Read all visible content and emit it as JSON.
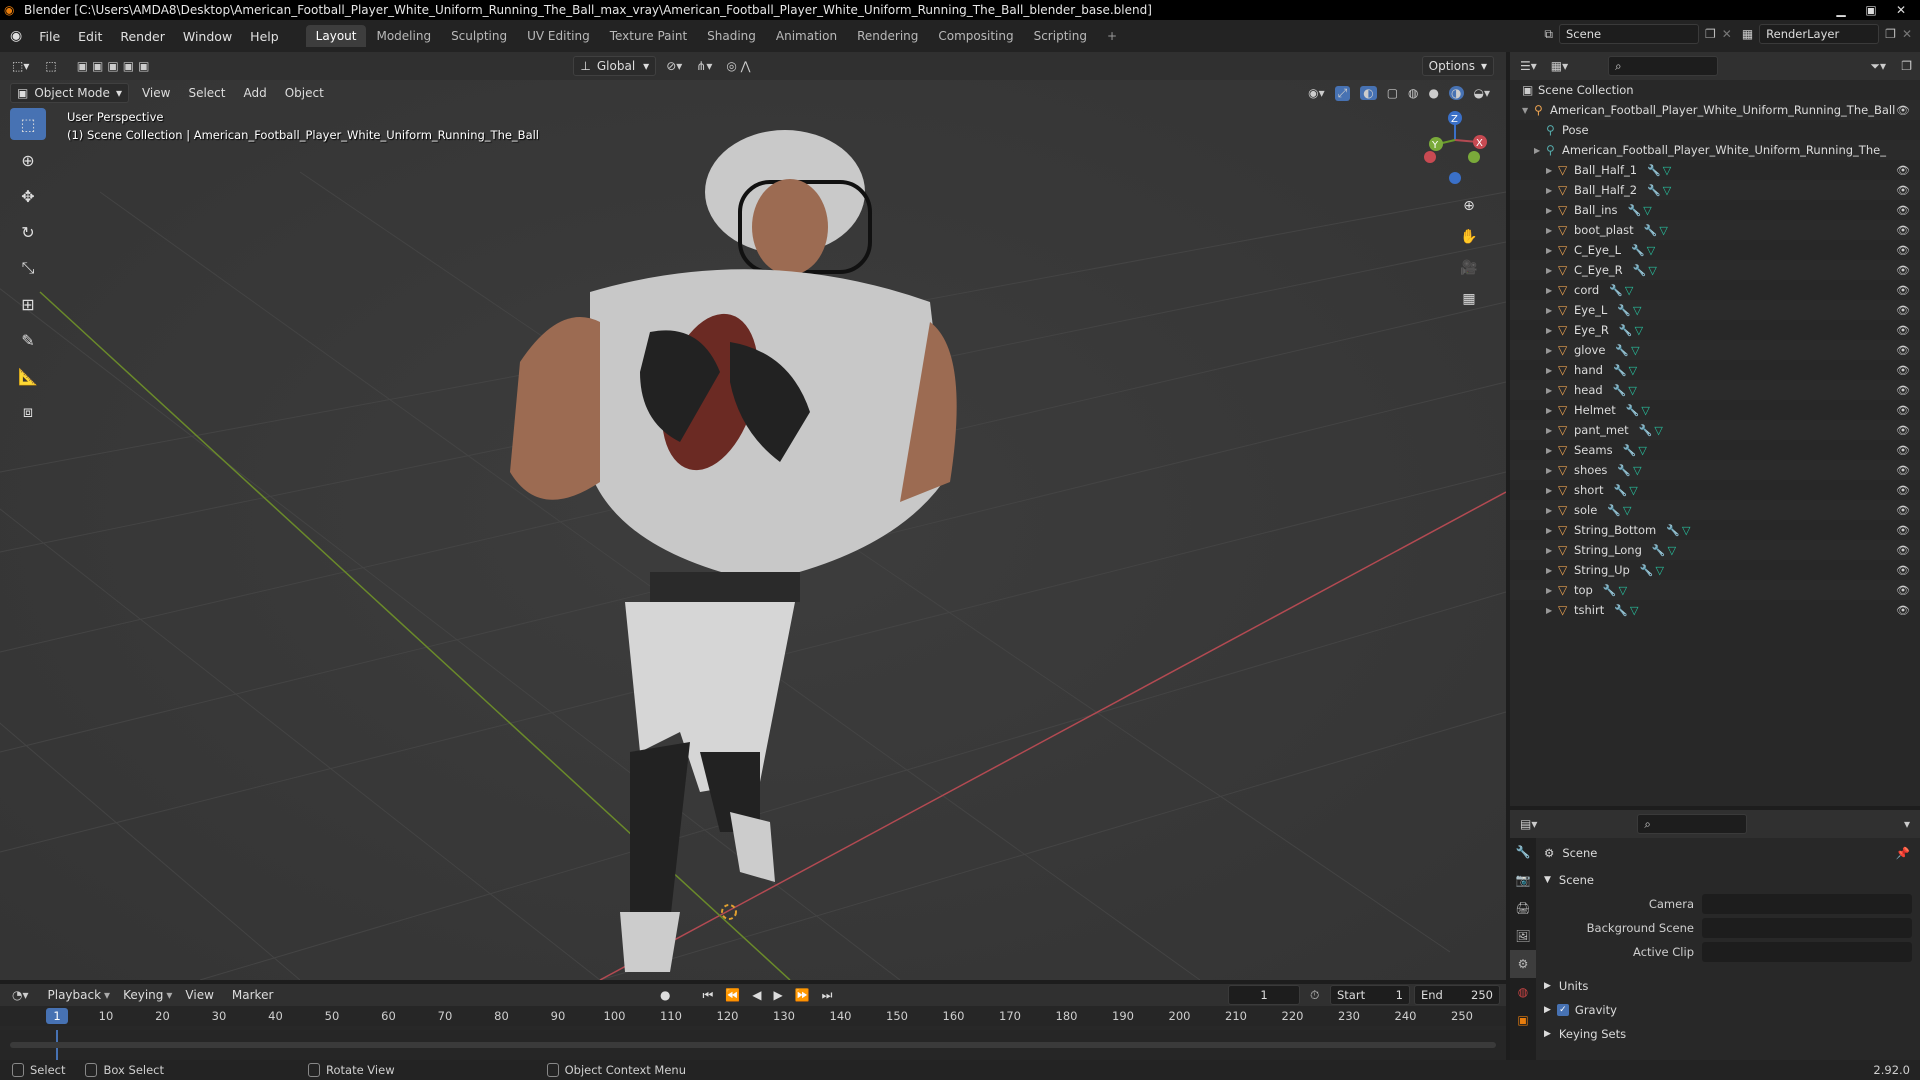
{
  "window": {
    "title": "Blender [C:\\Users\\AMDA8\\Desktop\\American_Football_Player_White_Uniform_Running_The_Ball_max_vray\\American_Football_Player_White_Uniform_Running_The_Ball_blender_base.blend]"
  },
  "menu": [
    "File",
    "Edit",
    "Render",
    "Window",
    "Help"
  ],
  "workspaces": [
    "Layout",
    "Modeling",
    "Sculpting",
    "UV Editing",
    "Texture Paint",
    "Shading",
    "Animation",
    "Rendering",
    "Compositing",
    "Scripting"
  ],
  "active_workspace": "Layout",
  "topbar_right": {
    "scene": "Scene",
    "render_layer": "RenderLayer"
  },
  "viewport": {
    "mode": "Object Mode",
    "menus": [
      "View",
      "Select",
      "Add",
      "Object"
    ],
    "orientation": "Global",
    "options": "Options",
    "info_line1": "User Perspective",
    "info_line2": "(1) Scene Collection | American_Football_Player_White_Uniform_Running_The_Ball",
    "gizmo": {
      "x": "X",
      "y": "Y",
      "z": "Z"
    }
  },
  "outliner": {
    "root": "Scene Collection",
    "armature": "American_Football_Player_White_Uniform_Running_The_Ball",
    "pose": "Pose",
    "armature_child": "American_Football_Player_White_Uniform_Running_The_",
    "objects": [
      "Ball_Half_1",
      "Ball_Half_2",
      "Ball_ins",
      "boot_plast",
      "C_Eye_L",
      "C_Eye_R",
      "cord",
      "Eye_L",
      "Eye_R",
      "glove",
      "hand",
      "head",
      "Helmet",
      "pant_met",
      "Seams",
      "shoes",
      "short",
      "sole",
      "String_Bottom",
      "String_Long",
      "String_Up",
      "top",
      "tshirt"
    ]
  },
  "properties": {
    "context": "Scene",
    "panel": "Scene",
    "camera_label": "Camera",
    "background_label": "Background Scene",
    "clip_label": "Active Clip",
    "sections": [
      "Units",
      "Gravity",
      "Keying Sets"
    ],
    "gravity_checked": true
  },
  "timeline": {
    "menus": [
      "Playback",
      "Keying",
      "View",
      "Marker"
    ],
    "current_frame": "1",
    "start_label": "Start",
    "start": "1",
    "end_label": "End",
    "end": "250",
    "ticks": [
      "10",
      "20",
      "30",
      "40",
      "50",
      "60",
      "70",
      "80",
      "90",
      "100",
      "110",
      "120",
      "130",
      "140",
      "150",
      "160",
      "170",
      "180",
      "190",
      "200",
      "210",
      "220",
      "230",
      "240",
      "250"
    ]
  },
  "statusbar": {
    "select": "Select",
    "box_select": "Box Select",
    "rotate": "Rotate View",
    "context_menu": "Object Context Menu",
    "version": "2.92.0"
  }
}
